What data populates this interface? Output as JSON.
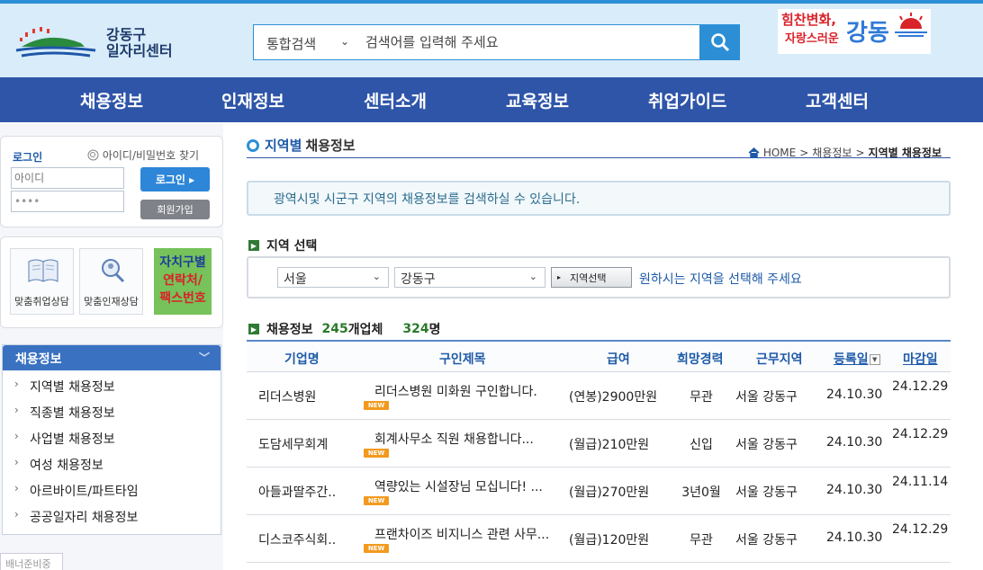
{
  "header": {
    "logo_line1": "강동구",
    "logo_line2": "일자리센터",
    "search": {
      "category": "통합검색",
      "placeholder": "검색어를 입력해 주세요"
    },
    "slogan": {
      "part1": "힘찬변화,",
      "part2": "자랑스러운",
      "part3": "강동"
    }
  },
  "nav": [
    "채용정보",
    "인재정보",
    "센터소개",
    "교육정보",
    "취업가이드",
    "고객센터"
  ],
  "login": {
    "title": "로그인",
    "find_link": "아이디/비밀번호 찾기",
    "id_placeholder": "아이디",
    "password_value": "••••",
    "login_button": "로그인",
    "join_button": "회원가입"
  },
  "quick_links": {
    "job_counsel": "맞춤취업상담",
    "talent_counsel": "맞춤인재상담",
    "district_contact": [
      "자치구별",
      "연락처/",
      "팩스번호"
    ]
  },
  "side_menu": {
    "title": "채용정보",
    "items": [
      "지역별 채용정보",
      "직종별 채용정보",
      "사업별 채용정보",
      "여성 채용정보",
      "아르바이트/파트타임",
      "공공일자리 채용정보"
    ]
  },
  "banner_tab": "배너준비중",
  "main": {
    "title_part1": "지역별",
    "title_part2": "채용정보",
    "breadcrumb": {
      "home": "HOME",
      "level1": "채용정보",
      "current": "지역별 채용정보",
      "sep": ">"
    },
    "info": "광역시및 시군구 지역의 채용정보를 검색하실 수 있습니다.",
    "region_section": "지역 선택",
    "region_city": "서울",
    "region_district": "강동구",
    "region_button": "지역선택",
    "region_hint": "원하시는 지역을 선택해 주세요",
    "jobs_section": "채용정보",
    "company_count": "245",
    "company_unit": "개업체",
    "person_count": "324",
    "person_unit": "명"
  },
  "table": {
    "headers": {
      "company": "기업명",
      "title": "구인제목",
      "pay": "급여",
      "career": "희망경력",
      "area": "근무지역",
      "registered": "등록일",
      "deadline": "마감일"
    },
    "new_badge": "NEW",
    "rows": [
      {
        "company": "리더스병원",
        "title": "리더스병원 미화원 구인합니다.",
        "pay": "(연봉)2900만원",
        "career": "무관",
        "area": "서울 강동구",
        "registered": "24.10.30",
        "deadline": "24.12.29"
      },
      {
        "company": "도담세무회계",
        "title": "회계사무소 직원 채용합니다...",
        "pay": "(월급)210만원",
        "career": "신입",
        "area": "서울 강동구",
        "registered": "24.10.30",
        "deadline": "24.12.29"
      },
      {
        "company": "아들과딸주간..",
        "title": "역량있는 시설장님 모십니다! ...",
        "pay": "(월급)270만원",
        "career": "3년0월",
        "area": "서울 강동구",
        "registered": "24.10.30",
        "deadline": "24.11.14"
      },
      {
        "company": "디스코주식회..",
        "title": "프랜차이즈 비지니스 관련 사무...",
        "pay": "(월급)120만원",
        "career": "무관",
        "area": "서울 강동구",
        "registered": "24.10.30",
        "deadline": "24.12.29"
      }
    ]
  },
  "colors": {
    "nav_bg": "#2f55a9",
    "accent": "#2c8fd6",
    "header_bg": "#d8ecfa",
    "count_green": "#2a7a2a",
    "new_badge": "#f29a1e"
  }
}
